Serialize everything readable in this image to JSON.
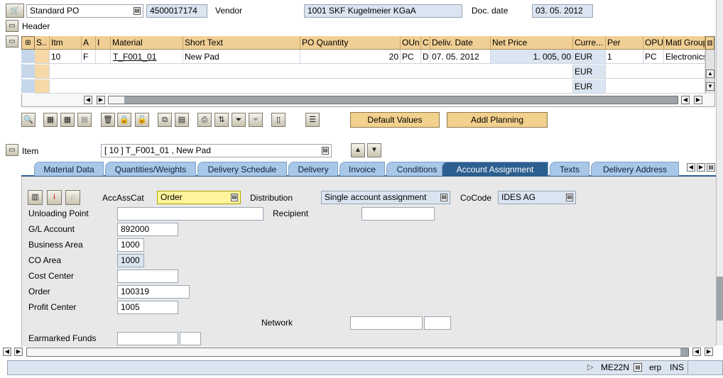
{
  "top": {
    "doc_type": "Standard PO",
    "po_number": "4500017174",
    "vendor_label": "Vendor",
    "vendor_value": "1001 SKF Kugelmeier KGaA",
    "doc_date_label": "Doc. date",
    "doc_date_value": "03. 05. 2012",
    "header_label": "Header"
  },
  "items_table": {
    "headers": [
      "S..",
      "Itm",
      "A",
      "I",
      "Material",
      "Short Text",
      "PO Quantity",
      "OUn",
      "C",
      "Deliv. Date",
      "Net Price",
      "Curre...",
      "Per",
      "OPU",
      "Matl Group"
    ],
    "row1": {
      "itm": "10",
      "a": "F",
      "i": "",
      "material": "T_F001_01",
      "short_text": "New Pad",
      "po_qty": "20",
      "oun": "PC",
      "c": "D",
      "deliv_date": "07. 05. 2012",
      "net_price": "1. 005, 00",
      "currency": "EUR",
      "per": "1",
      "opu": "PC",
      "matl_group": "Electronics"
    },
    "row2_currency": "EUR",
    "row3_currency": "EUR"
  },
  "buttons": {
    "default_values": "Default Values",
    "addl_planning": "Addl Planning"
  },
  "item_detail": {
    "item_label": "Item",
    "item_value": "[ 10 ] T_F001_01 , New Pad"
  },
  "tabs": [
    "Material Data",
    "Quantities/Weights",
    "Delivery Schedule",
    "Delivery",
    "Invoice",
    "Conditions",
    "Account Assignment",
    "Texts",
    "Delivery Address"
  ],
  "account_assignment": {
    "accasscat_label": "AccAssCat",
    "accasscat_value": "Order",
    "distribution_label": "Distribution",
    "distribution_value": "Single account assignment",
    "cocode_label": "CoCode",
    "cocode_value": "IDES AG",
    "unloading_point_label": "Unloading Point",
    "unloading_point_value": "",
    "recipient_label": "Recipient",
    "recipient_value": "",
    "gl_account_label": "G/L Account",
    "gl_account_value": "892000",
    "business_area_label": "Business Area",
    "business_area_value": "1000",
    "co_area_label": "CO Area",
    "co_area_value": "1000",
    "cost_center_label": "Cost Center",
    "cost_center_value": "",
    "order_label": "Order",
    "order_value": "100319",
    "profit_center_label": "Profit Center",
    "profit_center_value": "1005",
    "network_label": "Network",
    "earmarked_funds_label": "Earmarked Funds"
  },
  "status": {
    "transaction": "ME22N",
    "system": "erp",
    "mode": "INS"
  },
  "colors": {
    "grid_header": "#f1cf94",
    "readonly_field": "#dbe5f1",
    "active_tab": "#2c5f8f",
    "inactive_tab": "#a9c7e8",
    "panel_bg": "#e8e8e8",
    "button": "#f2d08d"
  }
}
